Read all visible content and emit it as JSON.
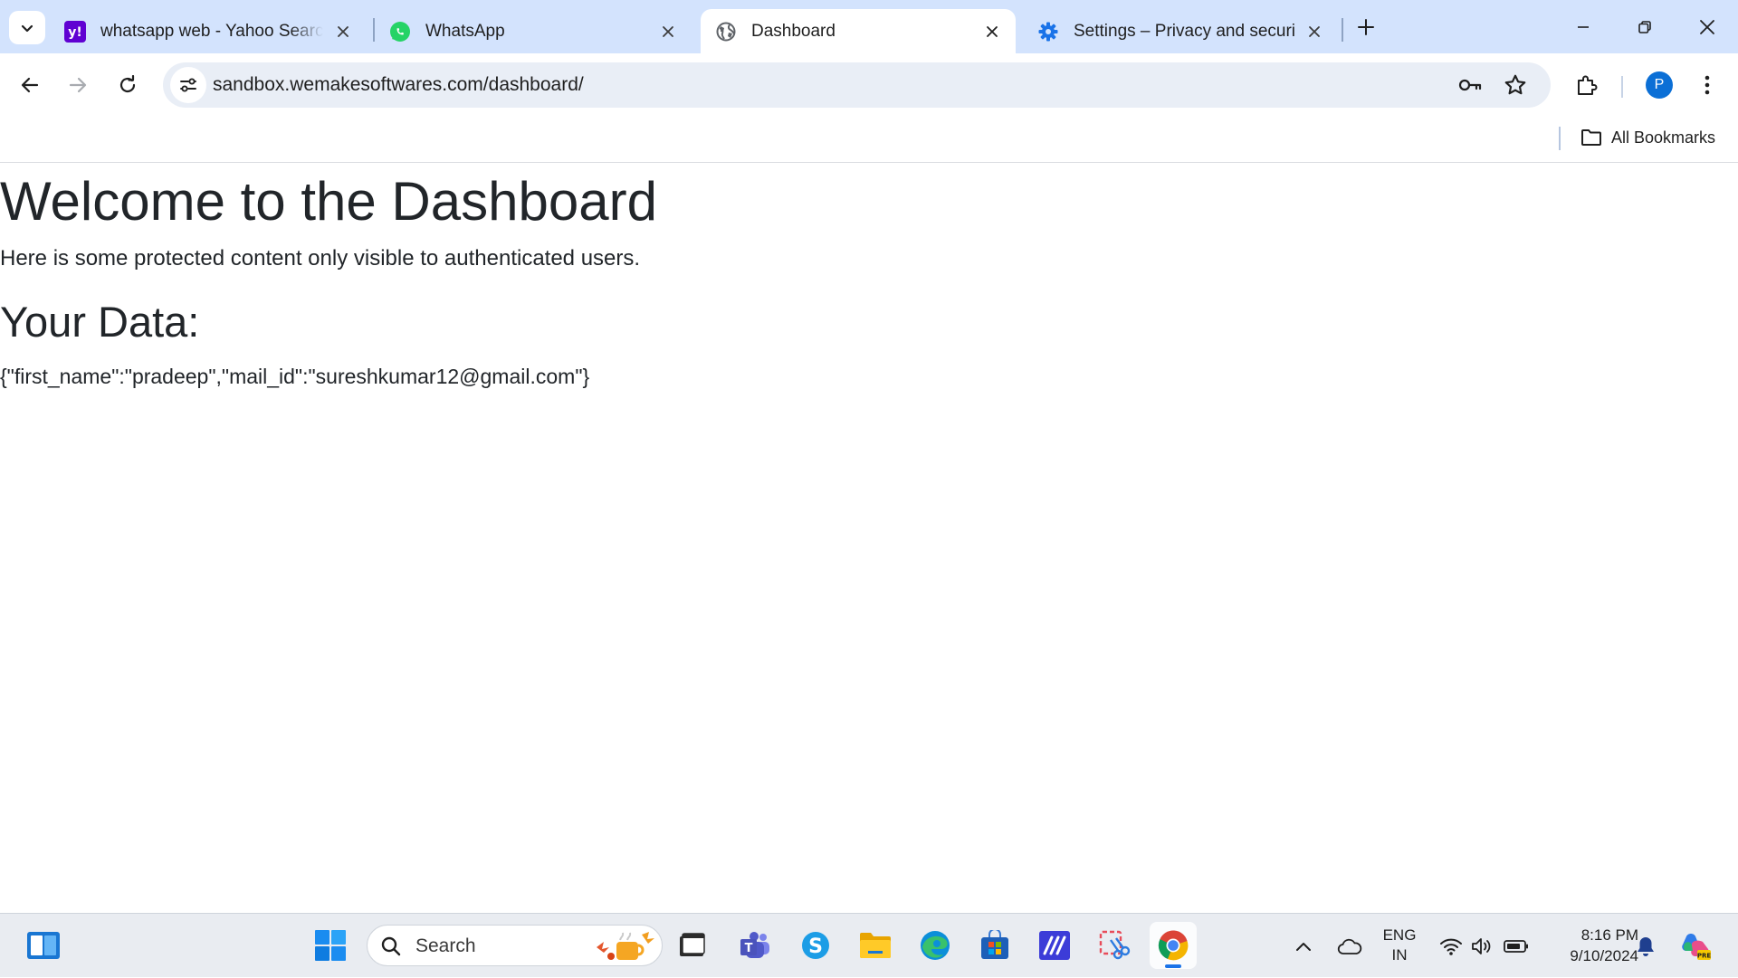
{
  "browser": {
    "tabs": [
      {
        "title": "whatsapp web - Yahoo Search R",
        "icon": "yahoo-icon",
        "active": false
      },
      {
        "title": "WhatsApp",
        "icon": "whatsapp-icon",
        "active": false
      },
      {
        "title": "Dashboard",
        "icon": "globe-icon",
        "active": true
      },
      {
        "title": "Settings – Privacy and security",
        "icon": "gear-icon",
        "active": false
      }
    ],
    "url": "sandbox.wemakesoftwares.com/dashboard/",
    "profile_initial": "P",
    "bookmarks": {
      "all_label": "All Bookmarks"
    }
  },
  "page": {
    "heading": "Welcome to the Dashboard",
    "intro": "Here is some protected content only visible to authenticated users.",
    "data_heading": "Your Data:",
    "data_json": "{\"first_name\":\"pradeep\",\"mail_id\":\"sureshkumar12@gmail.com\"}"
  },
  "taskbar": {
    "search_placeholder": "Search",
    "lang_line1": "ENG",
    "lang_line2": "IN",
    "time": "8:16 PM",
    "date": "9/10/2024"
  },
  "colors": {
    "tab_strip": "#d3e3fd",
    "omnibox": "#e9eef6",
    "accent": "#1a73e8",
    "text": "#212529"
  }
}
